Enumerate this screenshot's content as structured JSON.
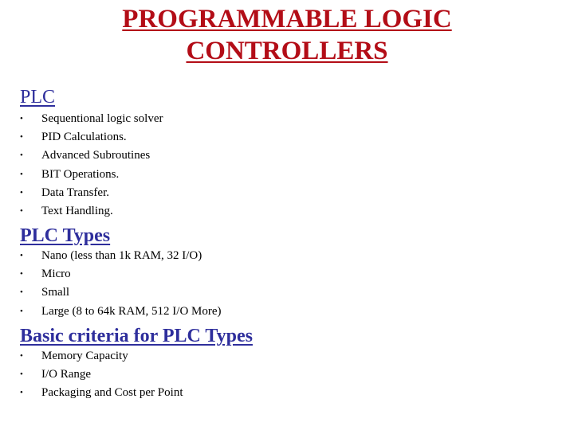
{
  "title": {
    "line1": "PROGRAMMABLE LOGIC",
    "line2": "CONTROLLERS",
    "color": "#b30d17"
  },
  "heading_color": "#2e2e9c",
  "sections": [
    {
      "heading": "PLC",
      "bullet_icon": "bullet-dot",
      "items": [
        "Sequentional logic solver",
        "PID Calculations.",
        "Advanced Subroutines",
        "BIT Operations.",
        "Data Transfer.",
        "Text Handling."
      ]
    },
    {
      "heading": "PLC Types",
      "bullet_icon": "bullet-dot",
      "items": [
        "Nano (less than 1k RAM, 32 I/O)",
        "Micro",
        "Small",
        "Large (8 to 64k RAM, 512 I/O More)"
      ]
    },
    {
      "heading": "Basic criteria for PLC Types",
      "bullet_icon": "bullet-dot",
      "items": [
        "Memory Capacity",
        "I/O Range",
        "Packaging and Cost per Point"
      ]
    }
  ],
  "bullet_glyph": "•"
}
